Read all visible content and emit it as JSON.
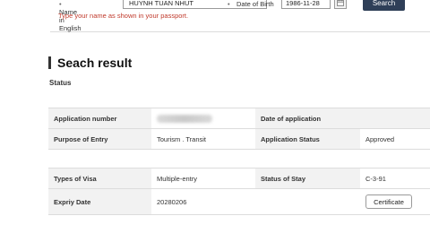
{
  "search_form": {
    "name_label": "Name in English",
    "name_value": "HUYNH TUAN NHUT",
    "dob_label": "Date of Birth",
    "dob_value": "1986-11-28",
    "search_button": "Search",
    "name_help": "Type your name as shown in your passport."
  },
  "page": {
    "section_title": "Seach result",
    "status_label": "Status"
  },
  "table1": {
    "application_number_label": "Application number",
    "application_number_value": "",
    "date_of_application_label": "Date of application",
    "date_of_application_value": "",
    "purpose_label": "Purpose of Entry",
    "purpose_value": "Tourism . Transit",
    "application_status_label": "Application Status",
    "application_status_value": "Approved"
  },
  "table2": {
    "types_label": "Types of Visa",
    "types_value": "Multiple-entry",
    "stay_label": "Status of Stay",
    "stay_value": "C-3-91",
    "expiry_label": "Expriy Date",
    "expiry_value": "20280206",
    "certificate_button": "Certificate"
  },
  "colors": {
    "accent_button": "#2f3f58",
    "help_text": "#c0392b",
    "label_cell_bg": "#f2f2f2"
  }
}
